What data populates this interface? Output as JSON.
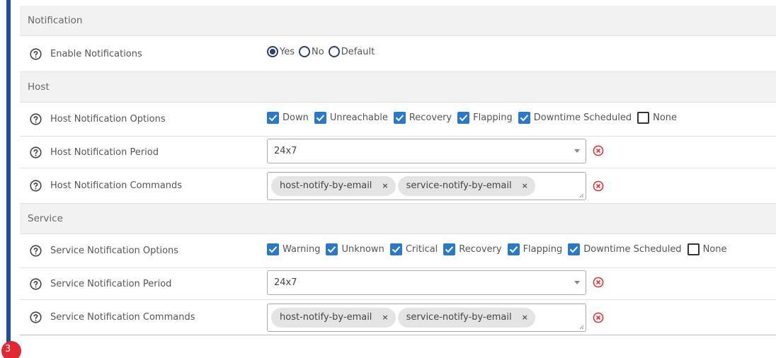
{
  "page_badge": "3",
  "sections": {
    "notification": {
      "title": "Notification",
      "enable": {
        "label": "Enable Notifications",
        "options": [
          "Yes",
          "No",
          "Default"
        ],
        "selected": "Yes"
      }
    },
    "host": {
      "title": "Host",
      "options": {
        "label": "Host Notification Options",
        "items": [
          {
            "label": "Down",
            "checked": true
          },
          {
            "label": "Unreachable",
            "checked": true
          },
          {
            "label": "Recovery",
            "checked": true
          },
          {
            "label": "Flapping",
            "checked": true
          },
          {
            "label": "Downtime Scheduled",
            "checked": true
          },
          {
            "label": "None",
            "checked": false
          }
        ]
      },
      "period": {
        "label": "Host Notification Period",
        "value": "24x7"
      },
      "commands": {
        "label": "Host Notification Commands",
        "tags": [
          "host-notify-by-email",
          "service-notify-by-email"
        ]
      }
    },
    "service": {
      "title": "Service",
      "options": {
        "label": "Service Notification Options",
        "items": [
          {
            "label": "Warning",
            "checked": true
          },
          {
            "label": "Unknown",
            "checked": true
          },
          {
            "label": "Critical",
            "checked": true
          },
          {
            "label": "Recovery",
            "checked": true
          },
          {
            "label": "Flapping",
            "checked": true
          },
          {
            "label": "Downtime Scheduled",
            "checked": true
          },
          {
            "label": "None",
            "checked": false
          }
        ]
      },
      "period": {
        "label": "Service Notification Period",
        "value": "24x7"
      },
      "commands": {
        "label": "Service Notification Commands",
        "tags": [
          "host-notify-by-email",
          "service-notify-by-email"
        ]
      }
    }
  },
  "colors": {
    "accent_bar": "#1f4f9c",
    "checkbox": "#2a79c9",
    "clear_icon": "#d9363e",
    "badge": "#e02732"
  },
  "icons": {
    "help": "question-circle-icon",
    "clear": "clear-circle-icon",
    "dropdown": "chevron-down-icon"
  }
}
